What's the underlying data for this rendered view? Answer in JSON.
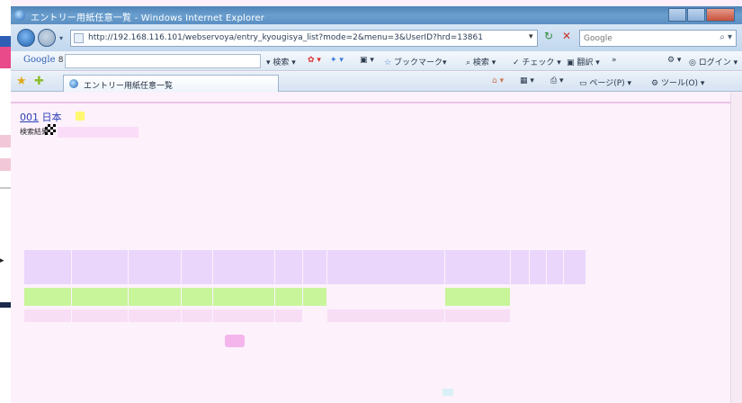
{
  "window": {
    "title": "エントリー用紙任意一覧 - Windows Internet Explorer"
  },
  "address_bar": {
    "url": "http://192.168.116.101/webservoya/entry_kyougisya_list?mode=2&menu=3&UserID?hrd=13861"
  },
  "search": {
    "placeholder": "Google"
  },
  "google_toolbar": {
    "logo": "Google",
    "logo_suffix": "8 ▾",
    "search_label": "検索",
    "bookmarks_label": "ブックマーク",
    "check_label": "チェック",
    "translate_label": "翻訳",
    "more_label": "»",
    "login_label": "ログイン"
  },
  "tabs": {
    "active_label": "エントリー用紙任意一覧"
  },
  "command_bar": {
    "page_label": "ページ(P)",
    "tools_label": "ツール(O)"
  },
  "page": {
    "header_num": "001",
    "header_text": "日本",
    "sub_text": "検索結果"
  },
  "table": {
    "columns": [
      "",
      "",
      "",
      "",
      "",
      "",
      "",
      "",
      "",
      "",
      "",
      "",
      ""
    ],
    "row1": [
      "",
      "",
      "",
      "",
      "",
      "",
      "",
      "",
      "",
      "",
      "",
      "",
      ""
    ],
    "row2": [
      "",
      "",
      "",
      "",
      "",
      "",
      "",
      "",
      "",
      "",
      "",
      "",
      ""
    ]
  },
  "colors": {
    "titlebar": "#5b8fc2",
    "content_bg": "#fdf0fb",
    "highlight_green": "#c8f59a",
    "header_purple": "#ead6fb",
    "link_blue": "#2a3fb8"
  }
}
